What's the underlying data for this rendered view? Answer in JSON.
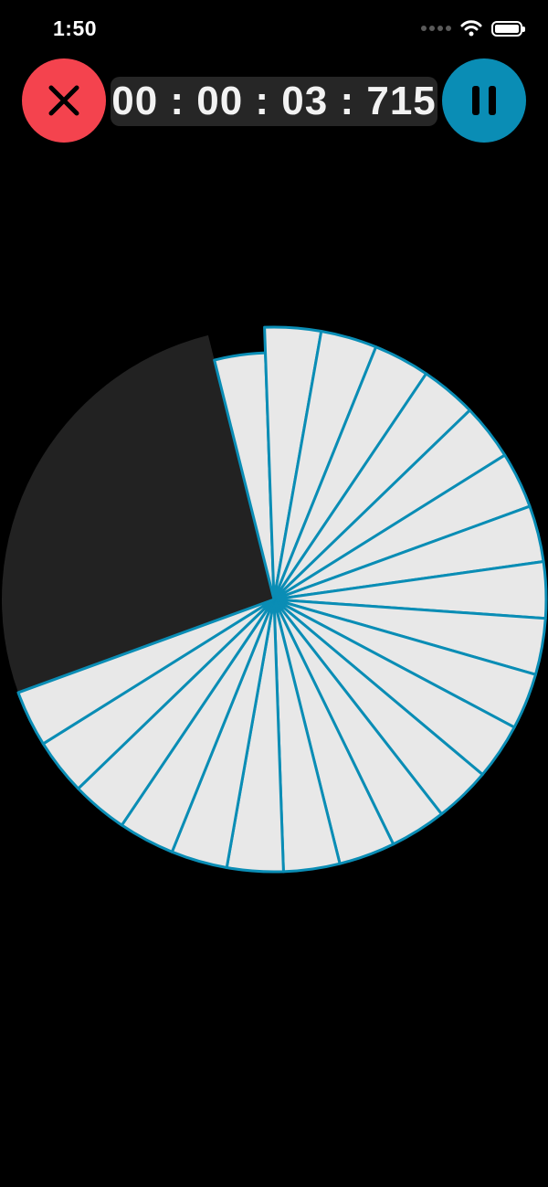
{
  "status_bar": {
    "time": "1:50",
    "icons": [
      "cellular-signal-icon",
      "wifi-icon",
      "battery-icon"
    ]
  },
  "controls": {
    "cancel_icon": "close-icon",
    "pause_icon": "pause-icon",
    "timer": "00 : 00 : 03 : 715"
  },
  "colors": {
    "background": "#000000",
    "cancel": "#f4434e",
    "pause": "#0a8db5",
    "slice_fill": "#e8e8e8",
    "slice_stroke": "#0a8db5",
    "elapsed_fill": "#222222",
    "timer_bg": "#262626"
  },
  "timer_wheel": {
    "total_slices": 30,
    "remaining_slices": 22,
    "elapsed_fraction": 0.2667
  }
}
